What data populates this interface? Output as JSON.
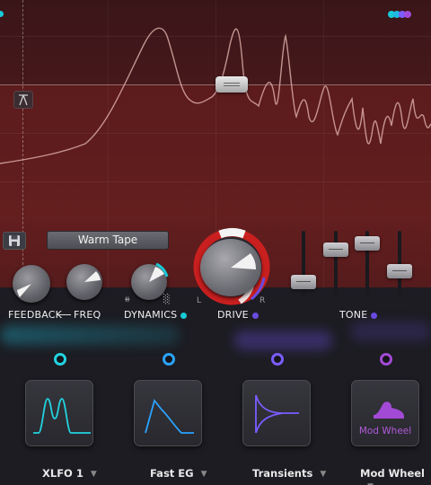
{
  "preset": {
    "name": "Warm Tape"
  },
  "knobs": {
    "feedback_label": "FEEDBACK",
    "freq_label": "FREQ",
    "dynamics_label": "DYNAMICS",
    "drive_label": "DRIVE",
    "drive_left": "L",
    "drive_right": "R",
    "tone_label": "TONE"
  },
  "modulators": [
    {
      "name": "XLFO 1",
      "color": "#22d3e0",
      "icon": "xlfo-waveform-icon"
    },
    {
      "name": "Fast EG",
      "color": "#2ba3ff",
      "icon": "envelope-icon"
    },
    {
      "name": "Transients",
      "color": "#7b5cff",
      "icon": "transients-icon"
    },
    {
      "name": "Mod Wheel",
      "color": "#a24ad6",
      "icon": "mod-wheel-icon",
      "tile_label": "Mod Wheel"
    }
  ],
  "colors": {
    "accent_cyan": "#19c9d6",
    "accent_blue": "#2ba3ff",
    "accent_purple": "#7b5cff",
    "accent_violet": "#a24ad6",
    "drive_ring": "#d42424"
  }
}
